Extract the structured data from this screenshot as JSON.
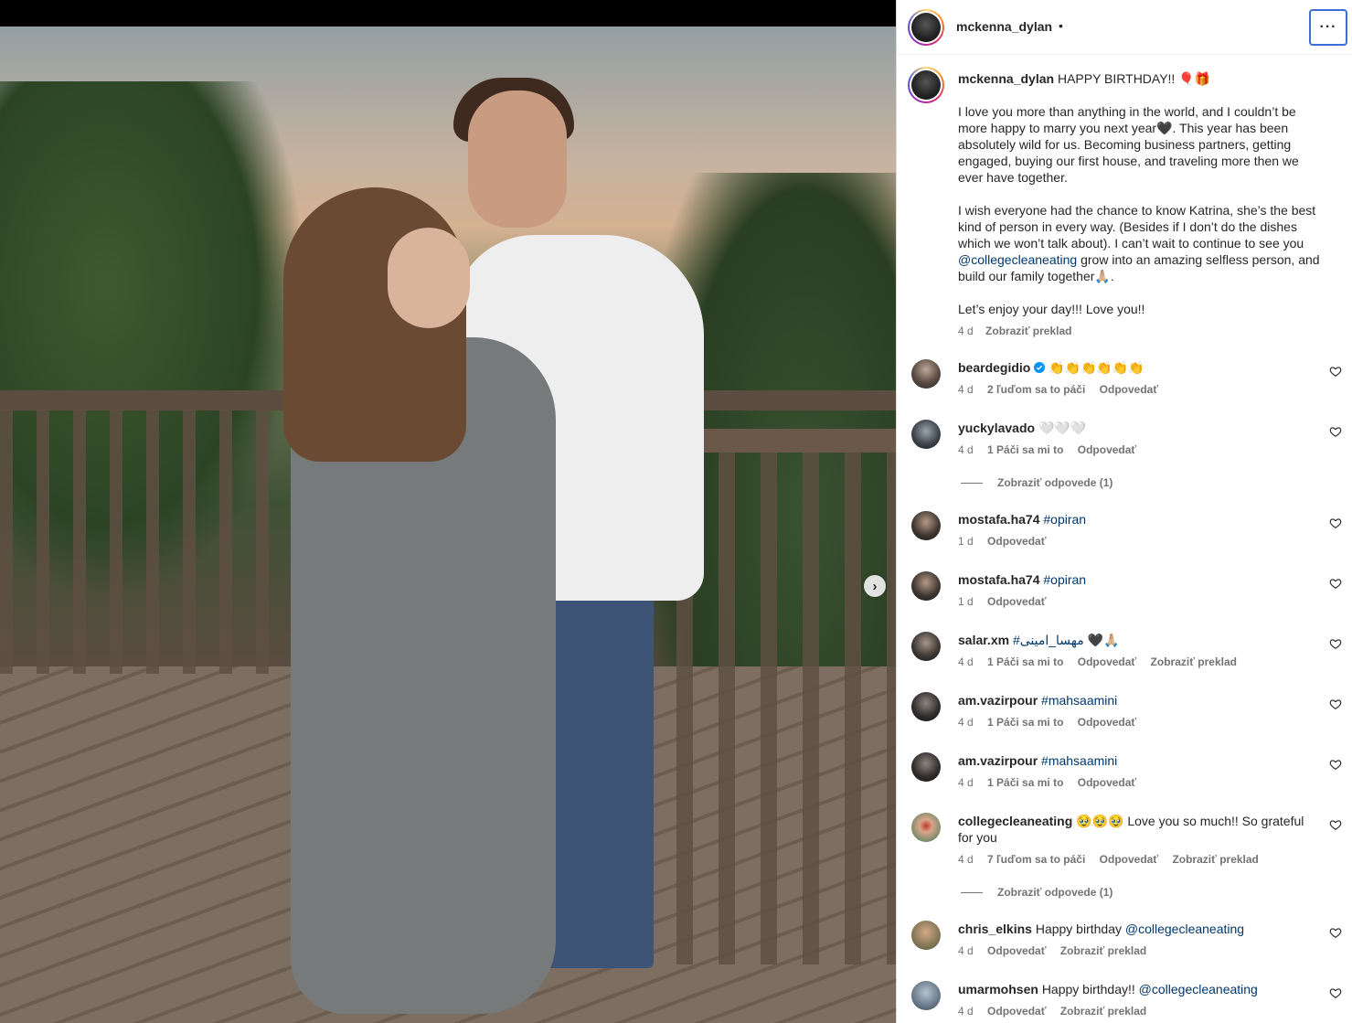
{
  "post": {
    "username": "mckenna_dylan",
    "header_dot": "•",
    "more_label": "···"
  },
  "caption": {
    "username": "mckenna_dylan",
    "first_line": "HAPPY BIRTHDAY!! 🎈🎁",
    "p1": "I love you more than anything in the world, and I couldn’t be more happy to marry you next year🖤. This year has been absolutely wild for us. Becoming business partners, getting engaged, buying our first house, and traveling more then we ever have together.",
    "p2_before": "I wish everyone had the chance to know Katrina, she’s the best kind of person in every way. (Besides if I don’t do the dishes which we won’t talk about). I can’t wait to continue to see you ",
    "p2_mention": "@collegecleaneating",
    "p2_after": " grow into an amazing selfless person, and build our family together🙏🏼.",
    "p3": "Let’s enjoy your day!!! Love you!!",
    "time": "4 d",
    "translate": "Zobraziť preklad"
  },
  "comments": [
    {
      "user": "beardegidio",
      "verified": true,
      "text": "👏👏👏👏👏👏",
      "time": "4 d",
      "likes": "2 ľuďom sa to páči",
      "reply": "Odpovedať",
      "translate": ""
    },
    {
      "user": "yuckylavado",
      "verified": false,
      "text": "🤍🤍🤍",
      "time": "4 d",
      "likes": "1 Páči sa mi to",
      "reply": "Odpovedať",
      "translate": ""
    },
    {
      "user": "mostafa.ha74",
      "verified": false,
      "text": "#opiran",
      "time": "1 d",
      "likes": "",
      "reply": "Odpovedať",
      "translate": ""
    },
    {
      "user": "mostafa.ha74",
      "verified": false,
      "text": "#opiran",
      "time": "1 d",
      "likes": "",
      "reply": "Odpovedať",
      "translate": ""
    },
    {
      "user": "salar.xm",
      "verified": false,
      "text": "#مهسا_امینی 🖤🙏🏼",
      "time": "4 d",
      "likes": "1 Páči sa mi to",
      "reply": "Odpovedať",
      "translate": "Zobraziť preklad"
    },
    {
      "user": "am.vazirpour",
      "verified": false,
      "text": "#mahsaamini",
      "time": "4 d",
      "likes": "1 Páči sa mi to",
      "reply": "Odpovedať",
      "translate": ""
    },
    {
      "user": "am.vazirpour",
      "verified": false,
      "text": "#mahsaamini",
      "time": "4 d",
      "likes": "1 Páči sa mi to",
      "reply": "Odpovedať",
      "translate": ""
    },
    {
      "user": "collegecleaneating",
      "verified": false,
      "text": "🥹🥹🥹 Love you so much!! So grateful for you",
      "time": "4 d",
      "likes": "7 ľuďom sa to páči",
      "reply": "Odpovedať",
      "translate": "Zobraziť preklad"
    },
    {
      "user": "chris_elkins",
      "verified": false,
      "text_before": "Happy birthday ",
      "mention": "@collegecleaneating",
      "time": "4 d",
      "likes": "",
      "reply": "Odpovedať",
      "translate": "Zobraziť preklad"
    },
    {
      "user": "umarmohsen",
      "verified": false,
      "text_before": "Happy birthday!! ",
      "mention": "@collegecleaneating",
      "time": "4 d",
      "likes": "",
      "reply": "Odpovedať",
      "translate": "Zobraziť preklad"
    }
  ],
  "view_replies": [
    "Zobraziť odpovede (1)",
    "Zobraziť odpovede (1)"
  ],
  "colors": {
    "link": "#00376b",
    "meta": "#737373",
    "verified": "#0095f6",
    "focus_ring": "#3b6fd8"
  },
  "icons": {
    "next": "chevron-right-icon",
    "like": "heart-outline-icon",
    "more": "more-horizontal-icon",
    "verified": "verified-badge-icon"
  }
}
